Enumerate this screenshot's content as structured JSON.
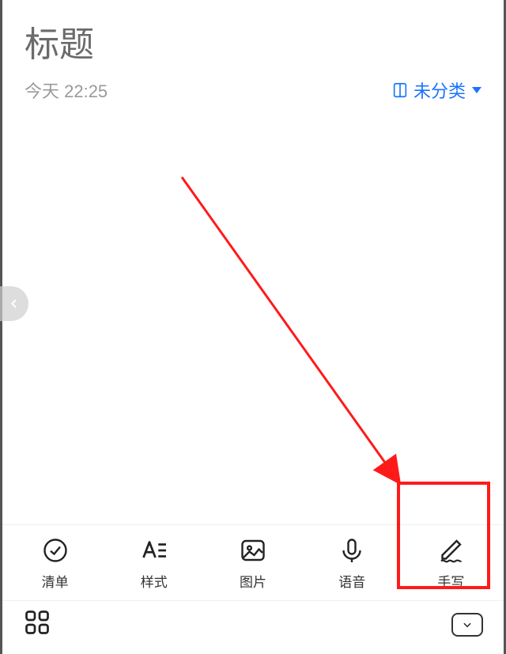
{
  "header": {
    "title_placeholder": "标题",
    "timestamp": "今天 22:25",
    "category_label": "未分类"
  },
  "toolbar": {
    "items": [
      {
        "label": "清单"
      },
      {
        "label": "样式"
      },
      {
        "label": "图片"
      },
      {
        "label": "语音"
      },
      {
        "label": "手写"
      }
    ]
  }
}
